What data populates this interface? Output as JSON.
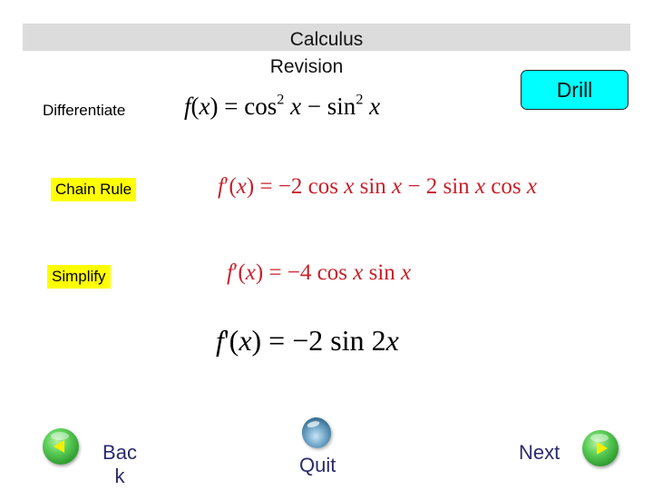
{
  "header": {
    "title_line1": "Calculus",
    "title_line2": "Revision"
  },
  "drill_button": {
    "label": "Drill",
    "color": "#00ffff"
  },
  "steps": [
    {
      "label": "Differentiate",
      "highlighted": false,
      "equation": {
        "text": "f(x) = cos² x − sin² x",
        "lhs": "f(x)",
        "rhs_parts": [
          "cos",
          "2",
          "x",
          "−",
          "sin",
          "2",
          "x"
        ],
        "color": "#000000"
      }
    },
    {
      "label": "Chain Rule",
      "highlighted": true,
      "equation": {
        "text": "f′(x) = −2 cos x sin x − 2 sin x cos x",
        "color": "#c8202a"
      }
    },
    {
      "label": "Simplify",
      "highlighted": true,
      "equation": {
        "text": "f′(x) = −4 cos x sin x",
        "color": "#c8202a"
      }
    },
    {
      "label": "",
      "highlighted": false,
      "equation": {
        "text": "f'(x) = −2 sin 2x",
        "color": "#000000"
      }
    }
  ],
  "highlight_color": "#ffff00",
  "nav": {
    "back": {
      "label_line1": "Bac",
      "label_line2": "k",
      "icon": "green-orb-left-arrow"
    },
    "quit": {
      "label": "Quit",
      "icon": "blue-orb"
    },
    "next": {
      "label": "Next",
      "icon": "green-orb-right-arrow"
    }
  },
  "math_tokens": {
    "f": "f",
    "x": "x",
    "prime": "′",
    "apostrophe": "'",
    "lp": "(",
    "rp": ")",
    "eq": " = ",
    "cos": "cos",
    "sin": "sin",
    "two": "2",
    "minus": " − ",
    "neg2": "−2 ",
    "neg4": "−4 ",
    "sq": "2",
    "two_sp": " 2 ",
    "two_x": "2"
  }
}
